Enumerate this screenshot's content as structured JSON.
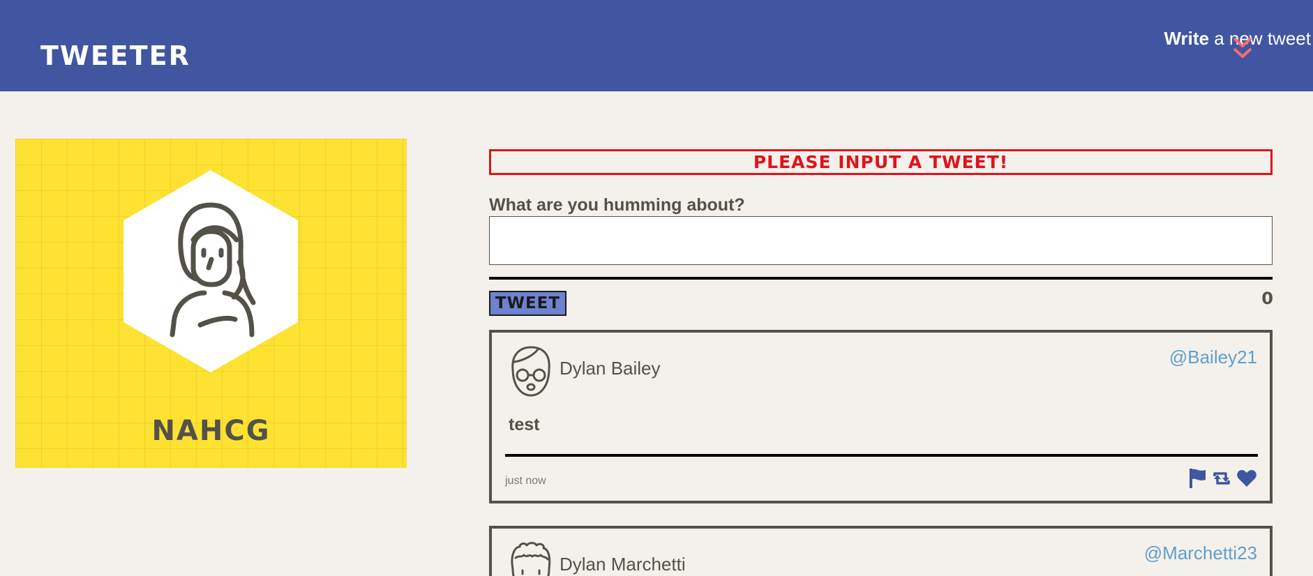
{
  "nav": {
    "brand": "Tweeter",
    "compose_bold": "Write",
    "compose_rest": " a new tweet",
    "compose_icon": "double-chevron-down-icon"
  },
  "profile": {
    "handle": "NAHCG",
    "avatar_icon": "user-avatar-icon"
  },
  "composer": {
    "error": "Please input a tweet!",
    "prompt": "What are you humming about?",
    "value": "",
    "submit_label": "TWEET",
    "counter": "0"
  },
  "tweets": [
    {
      "name": "Dylan Bailey",
      "handle": "@Bailey21",
      "text": "test",
      "time": "just now",
      "actions": [
        "flag-icon",
        "retweet-icon",
        "heart-icon"
      ]
    },
    {
      "name": "Dylan Marchetti",
      "handle": "@Marchetti23"
    }
  ],
  "colors": {
    "nav": "#4056a1",
    "background": "#f4f1ec",
    "profile": "#fde232",
    "error": "#e0121a",
    "accent": "#f76c6c",
    "handle": "#5f9fcc",
    "button": "#6e82d0"
  }
}
